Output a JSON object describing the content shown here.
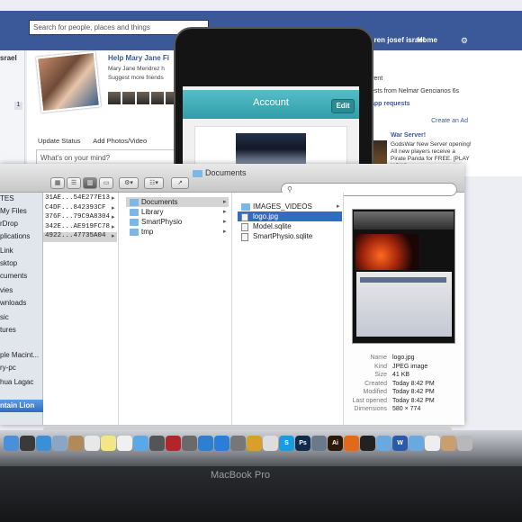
{
  "facebook": {
    "search_placeholder": "Search for people, places and things",
    "user_name": "ren josef israel",
    "home_label": "Home",
    "left_name": "srael",
    "left_badge": "1",
    "help_title": "Help Mary Jane Fi",
    "help_text": "Mary Jane Mendrez h Suggest more friends",
    "update_status": "Update Status",
    "add_photos": "Add Photos/Video",
    "whats_on_mind": "What's on your mind?",
    "right_event": "vent",
    "right_requests": "ests from Nelmar Gencianos 6s",
    "right_app_requests": "app requests",
    "create_ad": "Create an Ad",
    "ad_title": "War Server!",
    "ad_text": "GodsWar New Server opening! All new players receive a Pirate Panda for FREE. [PLAY NOW]"
  },
  "simulator": {
    "nav_title": "Account",
    "edit_label": "Edit"
  },
  "finder": {
    "title": "Documents",
    "search_icon": "search-icon",
    "sidebar": [
      "TES",
      "My Files",
      "rDrop",
      "plications",
      "Link",
      "sktop",
      "cuments",
      "vies",
      "wnloads",
      "sic",
      "tures",
      "ple Macint...",
      "ry-pc",
      "hua Lagac",
      "ntain Lion"
    ],
    "column1": [
      "31AE...54E277E13",
      "C4DF...842393CF",
      "376F...79C9A8304",
      "342E...AE919FC78",
      "4922...47735A04"
    ],
    "column2": [
      "Documents",
      "Library",
      "SmartPhysio",
      "tmp"
    ],
    "column3": [
      "IMAGES_VIDEOS",
      "logo.jpg",
      "Model.sqlite",
      "SmartPhysio.sqlite"
    ],
    "metadata": [
      {
        "label": "Name",
        "value": "logo.jpg"
      },
      {
        "label": "Kind",
        "value": "JPEG image"
      },
      {
        "label": "Size",
        "value": "41 KB"
      },
      {
        "label": "Created",
        "value": "Today 8:42 PM"
      },
      {
        "label": "Modified",
        "value": "Today 8:42 PM"
      },
      {
        "label": "Last opened",
        "value": "Today 8:42 PM"
      },
      {
        "label": "Dimensions",
        "value": "580 × 774"
      }
    ]
  },
  "dock": {
    "icons": [
      {
        "name": "finder-icon",
        "color": "#4a8fd8",
        "text": ""
      },
      {
        "name": "dashboard-icon",
        "color": "#3a3a3a",
        "text": ""
      },
      {
        "name": "safari-icon",
        "color": "#3b8fd6",
        "text": ""
      },
      {
        "name": "mail-icon",
        "color": "#8aa6c4",
        "text": ""
      },
      {
        "name": "contacts-icon",
        "color": "#b08a5a",
        "text": ""
      },
      {
        "name": "calendar-icon",
        "color": "#e8e8e8",
        "text": ""
      },
      {
        "name": "notes-icon",
        "color": "#f2e58a",
        "text": ""
      },
      {
        "name": "reminders-icon",
        "color": "#f0f0f0",
        "text": ""
      },
      {
        "name": "messages-icon",
        "color": "#5aa8e8",
        "text": ""
      },
      {
        "name": "facetime-icon",
        "color": "#555555",
        "text": ""
      },
      {
        "name": "photo-booth-icon",
        "color": "#b2262b",
        "text": ""
      },
      {
        "name": "iphoto-icon",
        "color": "#6a6a6a",
        "text": ""
      },
      {
        "name": "itunes-icon",
        "color": "#2f7fd0",
        "text": ""
      },
      {
        "name": "app-store-icon",
        "color": "#2b7ed8",
        "text": ""
      },
      {
        "name": "system-preferences-icon",
        "color": "#777777",
        "text": ""
      },
      {
        "name": "chrome-icon",
        "color": "#d8a02a",
        "text": ""
      },
      {
        "name": "preview-icon",
        "color": "#dddddd",
        "text": ""
      },
      {
        "name": "skype-icon",
        "color": "#1a9be0",
        "text": "S"
      },
      {
        "name": "photoshop-icon",
        "color": "#0f2a4a",
        "text": "Ps"
      },
      {
        "name": "xcode-icon",
        "color": "#6a7a8a",
        "text": ""
      },
      {
        "name": "illustrator-icon",
        "color": "#2b1a05",
        "text": "Ai"
      },
      {
        "name": "firefox-icon",
        "color": "#e06a1a",
        "text": ""
      },
      {
        "name": "terminal-icon",
        "color": "#222222",
        "text": ""
      },
      {
        "name": "folder-icon",
        "color": "#6aa8e0",
        "text": ""
      },
      {
        "name": "word-icon",
        "color": "#2a5aa8",
        "text": "W"
      },
      {
        "name": "downloads-icon",
        "color": "#6aa8e0",
        "text": ""
      },
      {
        "name": "document-icon",
        "color": "#eeeeee",
        "text": ""
      },
      {
        "name": "stack-icon",
        "color": "#c8a070",
        "text": ""
      },
      {
        "name": "trash-icon",
        "color": "#b8b8b8",
        "text": ""
      }
    ]
  },
  "device_brand": "MacBook Pro"
}
